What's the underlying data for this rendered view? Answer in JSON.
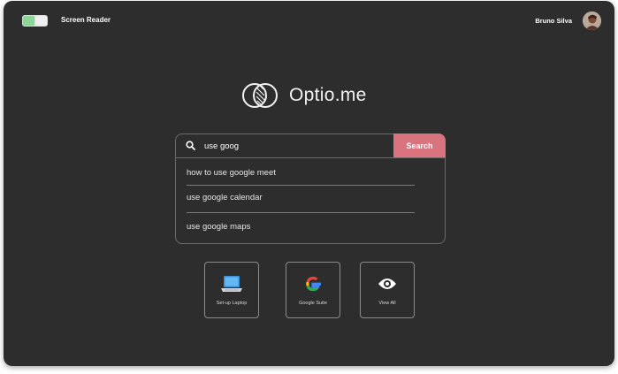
{
  "topbar": {
    "screen_reader_label": "Screen Reader",
    "user_name": "Bruno Silva"
  },
  "brand": {
    "logo_text": "Optio.me"
  },
  "search": {
    "query": "use goog",
    "button_label": "Search",
    "suggestions": [
      "how to use google meet",
      "use google calendar",
      "use google maps"
    ]
  },
  "quick_links": [
    {
      "label": "Set-up Laptop",
      "icon": "laptop-icon"
    },
    {
      "label": "Google Suite",
      "icon": "google-icon"
    },
    {
      "label": "View All",
      "icon": "eye-icon"
    }
  ],
  "colors": {
    "background": "#2d2d2d",
    "accent": "#d9737e",
    "toggle_on": "#8fd49a"
  }
}
